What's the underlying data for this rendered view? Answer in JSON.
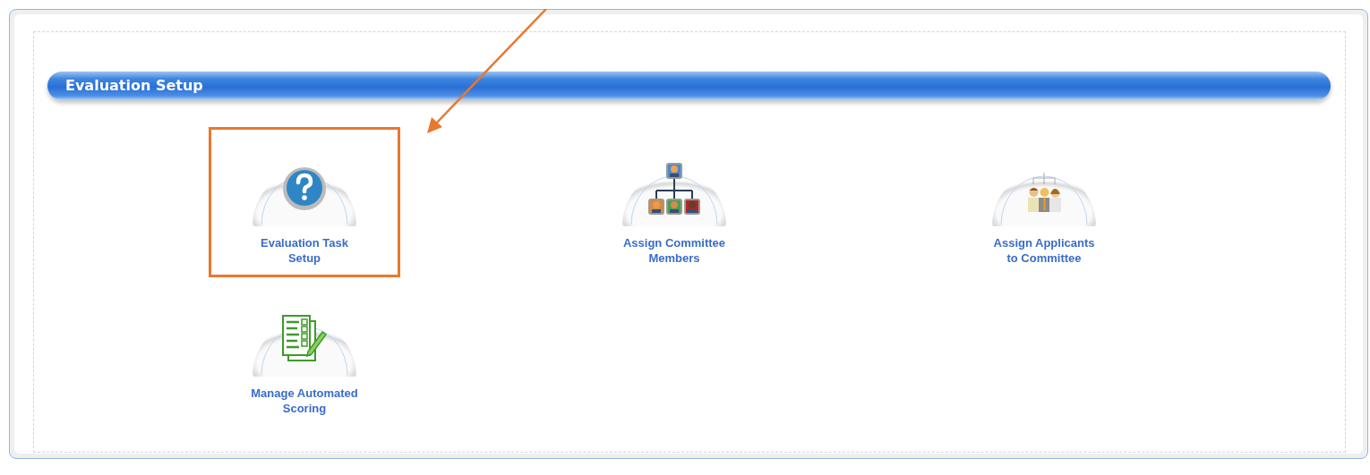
{
  "section": {
    "title": "Evaluation Setup"
  },
  "tiles": [
    {
      "label": "Evaluation Task\nSetup",
      "kind": "question",
      "highlighted": true
    },
    {
      "label": "Assign Committee\nMembers",
      "kind": "org-chart",
      "highlighted": false
    },
    {
      "label": "Assign Applicants\nto Committee",
      "kind": "people",
      "highlighted": false
    },
    {
      "label": "Manage Automated\nScoring",
      "kind": "checklist",
      "highlighted": false
    }
  ]
}
